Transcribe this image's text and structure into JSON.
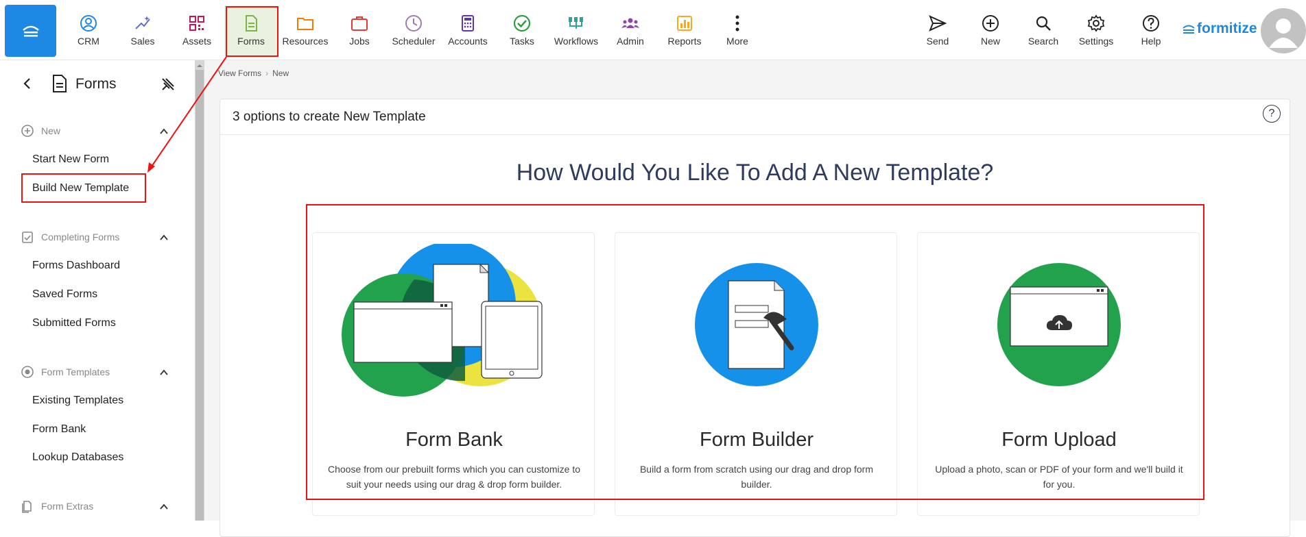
{
  "topnav": {
    "items": [
      {
        "label": "CRM",
        "icon": "crm-icon",
        "color": "#1e88e5"
      },
      {
        "label": "Sales",
        "icon": "sparkle-icon",
        "color": "#5b6fd6"
      },
      {
        "label": "Assets",
        "icon": "qr-icon",
        "color": "#c2185b"
      },
      {
        "label": "Forms",
        "icon": "form-icon",
        "color": "#7cb342"
      },
      {
        "label": "Resources",
        "icon": "folder-icon",
        "color": "#f57c00"
      },
      {
        "label": "Jobs",
        "icon": "briefcase-icon",
        "color": "#e53935"
      },
      {
        "label": "Scheduler",
        "icon": "clock-icon",
        "color": "#9c7cb8"
      },
      {
        "label": "Accounts",
        "icon": "calculator-icon",
        "color": "#5e35b1"
      },
      {
        "label": "Tasks",
        "icon": "check-circle-icon",
        "color": "#2e9e44"
      },
      {
        "label": "Workflows",
        "icon": "workflow-icon",
        "color": "#26a69a"
      },
      {
        "label": "Admin",
        "icon": "team-icon",
        "color": "#8e44ad"
      },
      {
        "label": "Reports",
        "icon": "reports-icon",
        "color": "#f9a825"
      },
      {
        "label": "More",
        "icon": "more-icon",
        "color": "#222222"
      }
    ],
    "right_items": [
      {
        "label": "Send",
        "icon": "send-icon"
      },
      {
        "label": "New",
        "icon": "plus-circle-icon"
      },
      {
        "label": "Search",
        "icon": "search-icon"
      },
      {
        "label": "Settings",
        "icon": "gear-icon"
      },
      {
        "label": "Help",
        "icon": "help-icon"
      }
    ],
    "brand": "formitize"
  },
  "sidebar": {
    "title": "Forms",
    "sections": [
      {
        "label": "New",
        "links": [
          "Start New Form",
          "Build New Template"
        ]
      },
      {
        "label": "Completing Forms",
        "links": [
          "Forms Dashboard",
          "Saved Forms",
          "Submitted Forms"
        ]
      },
      {
        "label": "Form Templates",
        "links": [
          "Existing Templates",
          "Form Bank",
          "Lookup Databases"
        ]
      },
      {
        "label": "Form Extras",
        "links": []
      }
    ]
  },
  "breadcrumb": [
    "View Forms",
    "New"
  ],
  "card": {
    "title": "3 options to create New Template",
    "help": "?",
    "question": "How Would You Like To Add A New Template?",
    "options": [
      {
        "title": "Form Bank",
        "desc": "Choose from our prebuilt forms which you can customize to suit your needs using our drag & drop form builder."
      },
      {
        "title": "Form Builder",
        "desc": "Build a form from scratch using our drag and drop form builder."
      },
      {
        "title": "Form Upload",
        "desc": "Upload a photo, scan or PDF of your form and we'll build it for you."
      }
    ]
  },
  "colors": {
    "accent": "#1e88e5",
    "highlight": "#ee1111",
    "green": "#23a24d",
    "blue": "#1591ea",
    "yellow": "#ebe33f"
  }
}
